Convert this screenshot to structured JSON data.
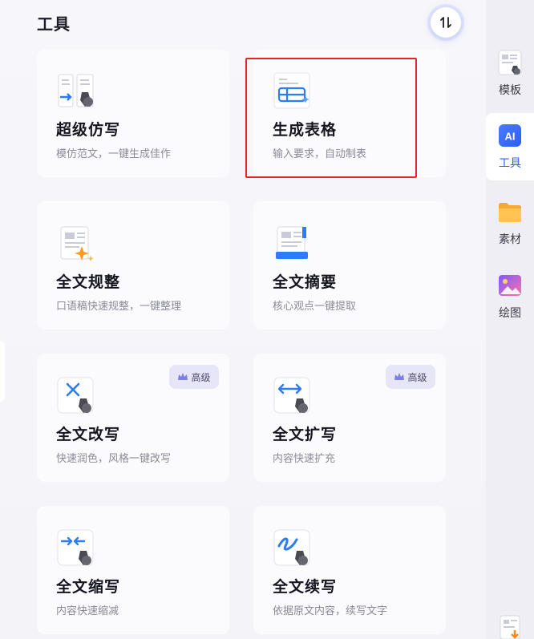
{
  "header": {
    "title": "工具"
  },
  "cards": [
    {
      "title": "超级仿写",
      "desc": "模仿范文，一键生成佳作",
      "icon": "copy-write-icon"
    },
    {
      "title": "生成表格",
      "desc": "输入要求，自动制表",
      "icon": "table-icon"
    },
    {
      "title": "全文规整",
      "desc": "口语稿快速规整，一键整理",
      "icon": "sparkle-doc-icon"
    },
    {
      "title": "全文摘要",
      "desc": "核心观点一键提取",
      "icon": "summary-doc-icon"
    },
    {
      "title": "全文改写",
      "desc": "快速润色，风格一键改写",
      "icon": "rewrite-icon",
      "badge": "高级"
    },
    {
      "title": "全文扩写",
      "desc": "内容快速扩充",
      "icon": "expand-icon",
      "badge": "高级"
    },
    {
      "title": "全文缩写",
      "desc": "内容快速缩减",
      "icon": "shrink-icon"
    },
    {
      "title": "全文续写",
      "desc": "依据原文内容，续写文字",
      "icon": "continue-icon"
    }
  ],
  "sidebar": {
    "items": [
      {
        "label": "模板",
        "icon": "template-icon"
      },
      {
        "label": "工具",
        "icon": "ai-icon",
        "icon_text": "AI",
        "active": true
      },
      {
        "label": "素材",
        "icon": "folder-icon"
      },
      {
        "label": "绘图",
        "icon": "image-icon"
      }
    ]
  },
  "colors": {
    "accent": "#2d5cf6",
    "highlight": "#e5242b",
    "badge_bg": "#e6e6f8"
  }
}
